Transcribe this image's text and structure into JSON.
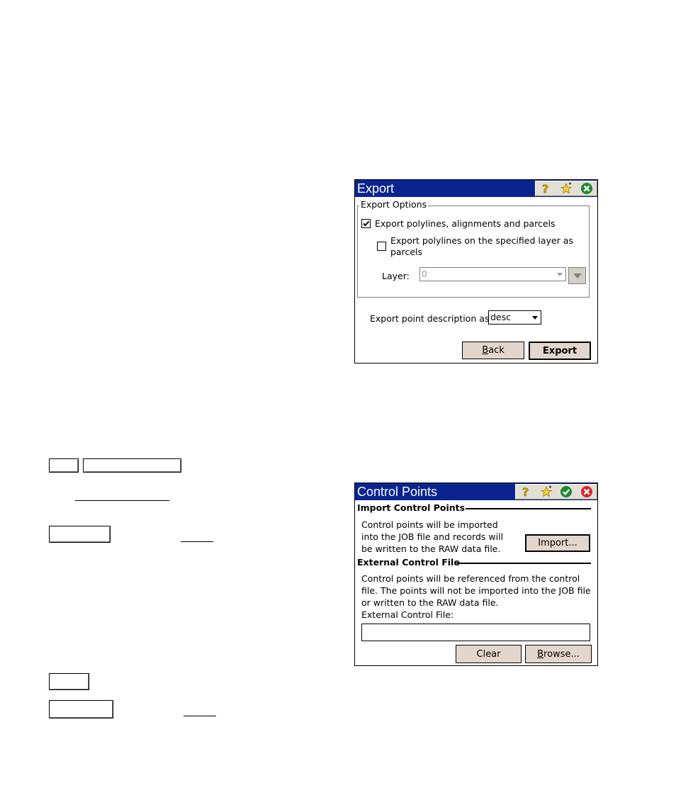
{
  "export_dialog": {
    "title": "Export",
    "group_title": "Export Options",
    "checkbox1_label": "Export polylines, alignments and parcels",
    "checkbox1_checked": true,
    "checkbox2_label_line1": "Export polylines on the specified layer as",
    "checkbox2_label_line2": "parcels",
    "checkbox2_checked": false,
    "layer_label": "Layer:",
    "layer_value": "0",
    "desc_label": "Export point description as",
    "desc_value": "desc",
    "back_label_u": "B",
    "back_label_rest": "ack",
    "export_label": "Export",
    "icons": [
      "help-icon",
      "favorite-star-icon",
      "close-icon"
    ]
  },
  "control_dialog": {
    "title": "Control Points",
    "import_section": "Import Control Points",
    "import_text_1": "Control points will be imported",
    "import_text_2": "into the JOB file and records will",
    "import_text_3": "be written to the RAW data file.",
    "import_button": "Import...",
    "external_section": "External Control File",
    "external_text_1": "Control points will be referenced from the control",
    "external_text_2": "file. The points will not be imported into the JOB file",
    "external_text_3": "or written to the RAW data file.",
    "external_field_label": "External Control File:",
    "external_field_value": "",
    "clear_button": "Clear",
    "browse_label_u": "B",
    "browse_label_rest": "rowse...",
    "icons": [
      "help-icon",
      "favorite-star-icon",
      "ok-check-icon",
      "close-icon"
    ]
  },
  "colors": {
    "titlebar": "#0a248f",
    "button_face": "#e2d6cd",
    "close_green": "#1e8a2e",
    "close_red": "#d9262c"
  }
}
